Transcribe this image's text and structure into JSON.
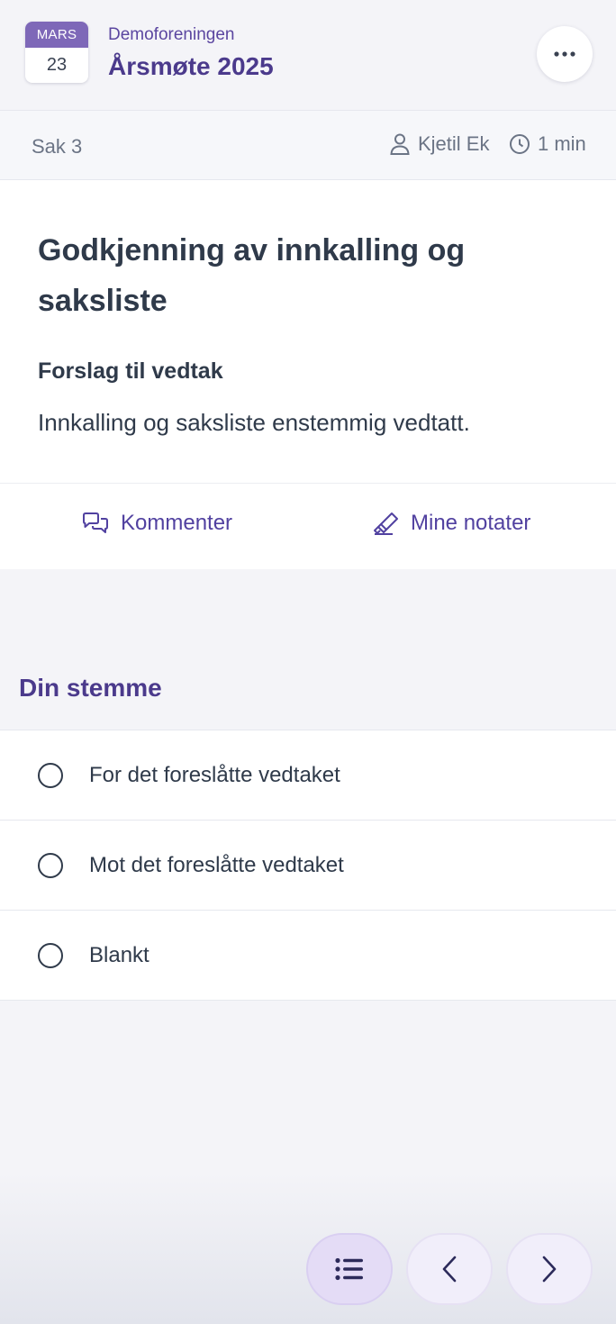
{
  "header": {
    "calendar": {
      "month": "MARS",
      "day": "23"
    },
    "organization": "Demoforeningen",
    "meeting_title": "Årsmøte 2025",
    "more_icon": "ellipsis-icon"
  },
  "subbar": {
    "item_number": "Sak 3",
    "presenter": "Kjetil Ek",
    "duration": "1 min"
  },
  "item": {
    "title": "Godkjenning av innkalling og saksliste",
    "proposal_label": "Forslag til vedtak",
    "proposal_text": "Innkalling og saksliste enstemmig vedtatt."
  },
  "actions": {
    "comment_label": "Kommenter",
    "notes_label": "Mine notater"
  },
  "vote": {
    "heading": "Din stemme",
    "options": [
      {
        "label": "For det foreslåtte vedtaket",
        "selected": false
      },
      {
        "label": "Mot det foreslåtte vedtaket",
        "selected": false
      },
      {
        "label": "Blankt",
        "selected": false
      }
    ]
  },
  "bottom_nav": {
    "buttons": [
      "list-icon",
      "chevron-left-icon",
      "chevron-right-icon"
    ],
    "active": "list-icon"
  },
  "colors": {
    "accent": "#4b3a8c",
    "calendar_header": "#7e68b8",
    "link": "#5141a0"
  }
}
